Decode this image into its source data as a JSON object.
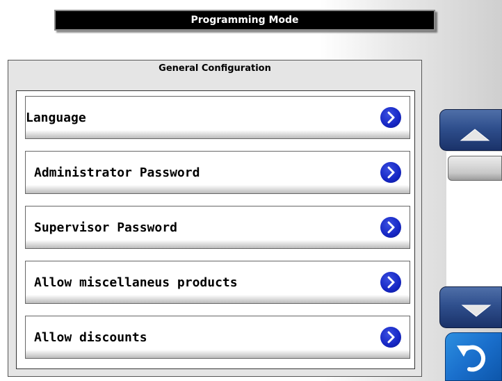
{
  "title": "Programming Mode",
  "panel": {
    "title": "General Configuration",
    "items": [
      {
        "label": "Language"
      },
      {
        "label": "Administrator Password"
      },
      {
        "label": "Supervisor Password"
      },
      {
        "label": "Allow miscellaneus products"
      },
      {
        "label": "Allow discounts"
      }
    ]
  },
  "icons": {
    "item_chevron": "chevron-right-icon",
    "scroll_up": "triangle-up-icon",
    "scroll_down": "triangle-down-icon",
    "back": "undo-arrow-icon"
  },
  "colors": {
    "chevron": "#1526c4",
    "scroll_button": "#2f4f8d",
    "back_button": "#1a6fcc"
  }
}
